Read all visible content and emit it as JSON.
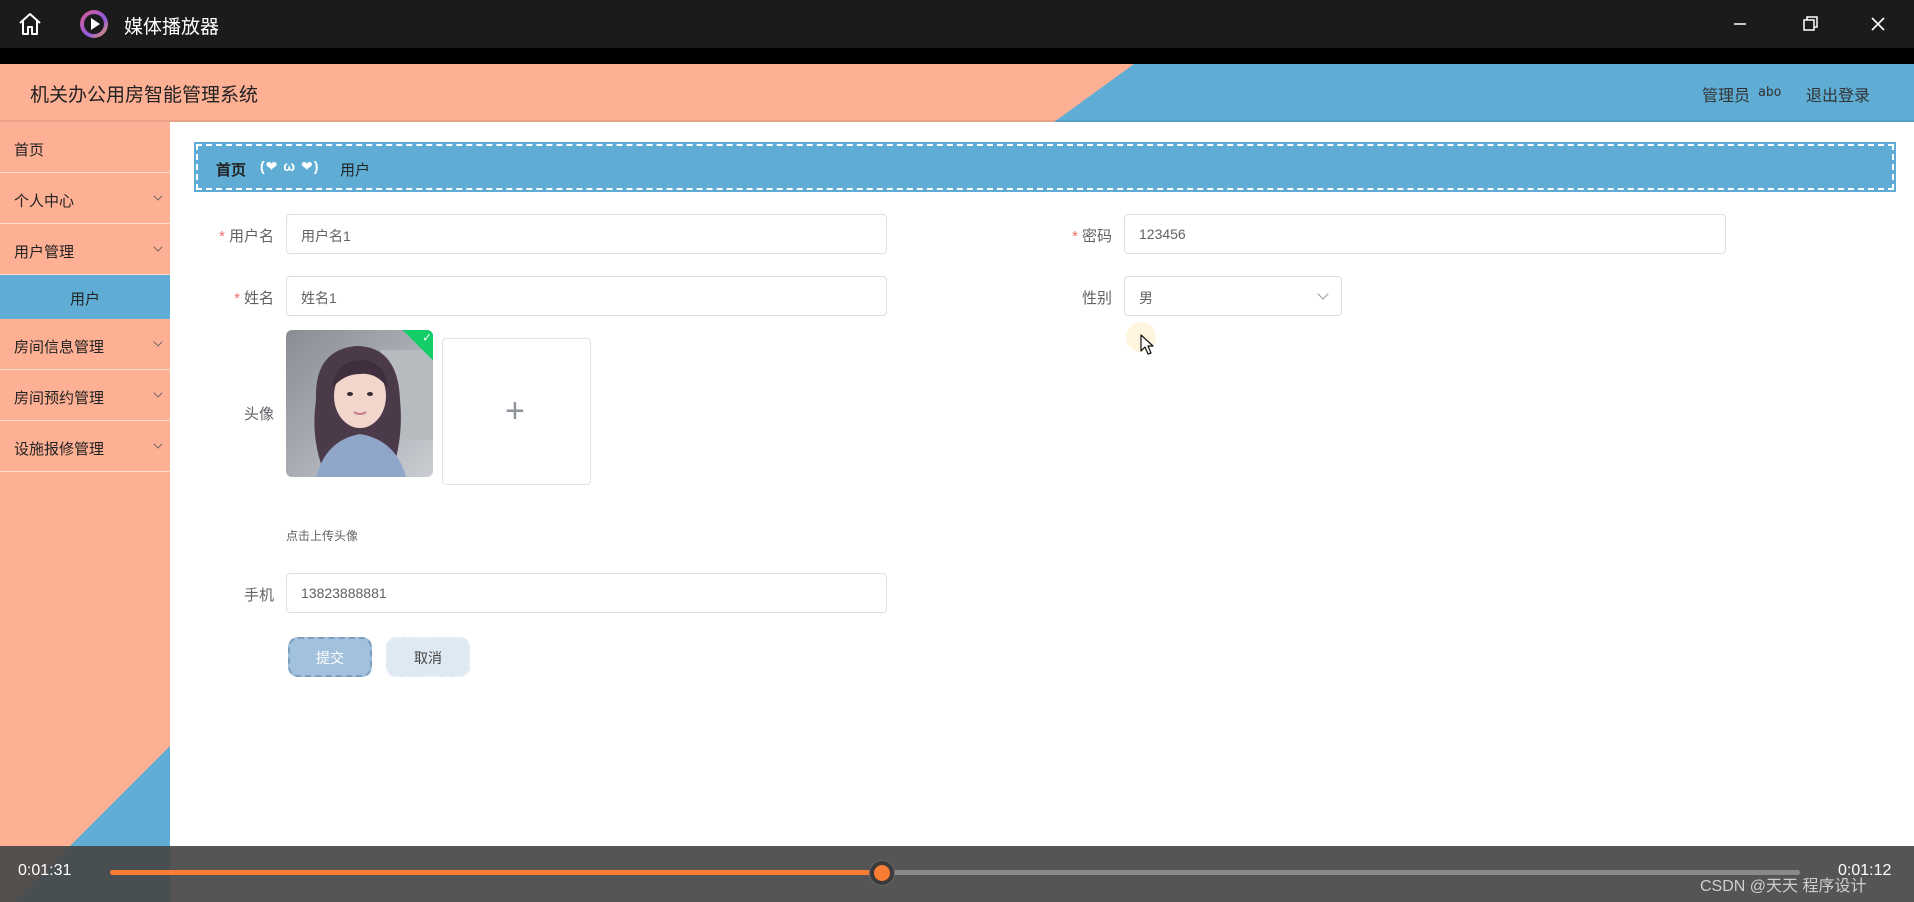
{
  "player": {
    "title": "媒体播放器",
    "time_current": "0:01:31",
    "time_total": "0:01:12",
    "progress": 0.457,
    "accent": "#f97c35",
    "watermark": "CSDN @天天 程序设计"
  },
  "header": {
    "app_title": "机关办公用房智能管理系统",
    "admin_label": "管理员",
    "admin_name": "abo",
    "logout": "退出登录",
    "colors": {
      "salmon": "#fdb094",
      "blue": "#5fadd5"
    }
  },
  "sidebar": {
    "items": [
      {
        "label": "首页",
        "expandable": false
      },
      {
        "label": "个人中心",
        "expandable": true
      },
      {
        "label": "用户管理",
        "expandable": true
      },
      {
        "label": "用户",
        "sub": true,
        "active": true
      },
      {
        "label": "房间信息管理",
        "expandable": true
      },
      {
        "label": "房间预约管理",
        "expandable": true
      },
      {
        "label": "设施报修管理",
        "expandable": true
      }
    ]
  },
  "breadcrumb": {
    "home": "首页",
    "separator": "(❤ ω ❤)",
    "current": "用户"
  },
  "form": {
    "username": {
      "label": "用户名",
      "required": true,
      "value": "用户名1"
    },
    "password": {
      "label": "密码",
      "required": true,
      "value": "123456"
    },
    "name": {
      "label": "姓名",
      "required": true,
      "value": "姓名1"
    },
    "gender": {
      "label": "性别",
      "value": "男"
    },
    "avatar": {
      "label": "头像",
      "tip": "点击上传头像"
    },
    "phone": {
      "label": "手机",
      "value": "13823888881"
    },
    "submit": "提交",
    "cancel": "取消"
  }
}
